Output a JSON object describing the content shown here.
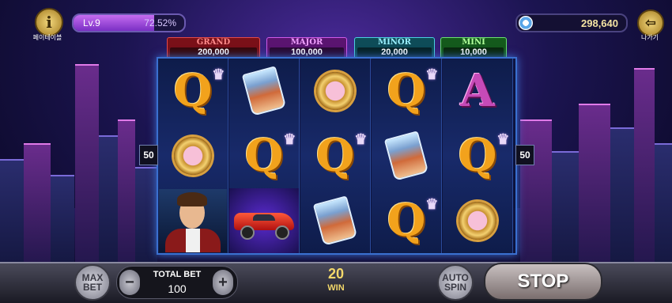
{
  "header": {
    "info_label": "페이테이블",
    "level_text": "Lv.9",
    "level_percent": "72.52%",
    "level_progress": 0.7252,
    "coins": "298,640",
    "exit_label": "나가기"
  },
  "jackpots": {
    "grand": {
      "title": "GRAND",
      "value": "200,000"
    },
    "major": {
      "title": "MAJOR",
      "value": "100,000"
    },
    "minor": {
      "title": "MINOR",
      "value": "20,000"
    },
    "mini": {
      "title": "MINI",
      "value": "10,000"
    }
  },
  "reels": [
    [
      "Q",
      "watch",
      "man"
    ],
    [
      "glass",
      "Q",
      "car"
    ],
    [
      "watch",
      "Q",
      "glass"
    ],
    [
      "Q",
      "glass",
      "Q"
    ],
    [
      "A",
      "Q",
      "watch"
    ]
  ],
  "lines_left": "50",
  "lines_right": "50",
  "bottom": {
    "max_bet": "MAX BET",
    "total_bet_label": "TOTAL BET",
    "total_bet_value": "100",
    "win_value": "20",
    "win_label": "WIN",
    "auto_spin": "AUTO SPIN",
    "stop_label": "STOP"
  }
}
